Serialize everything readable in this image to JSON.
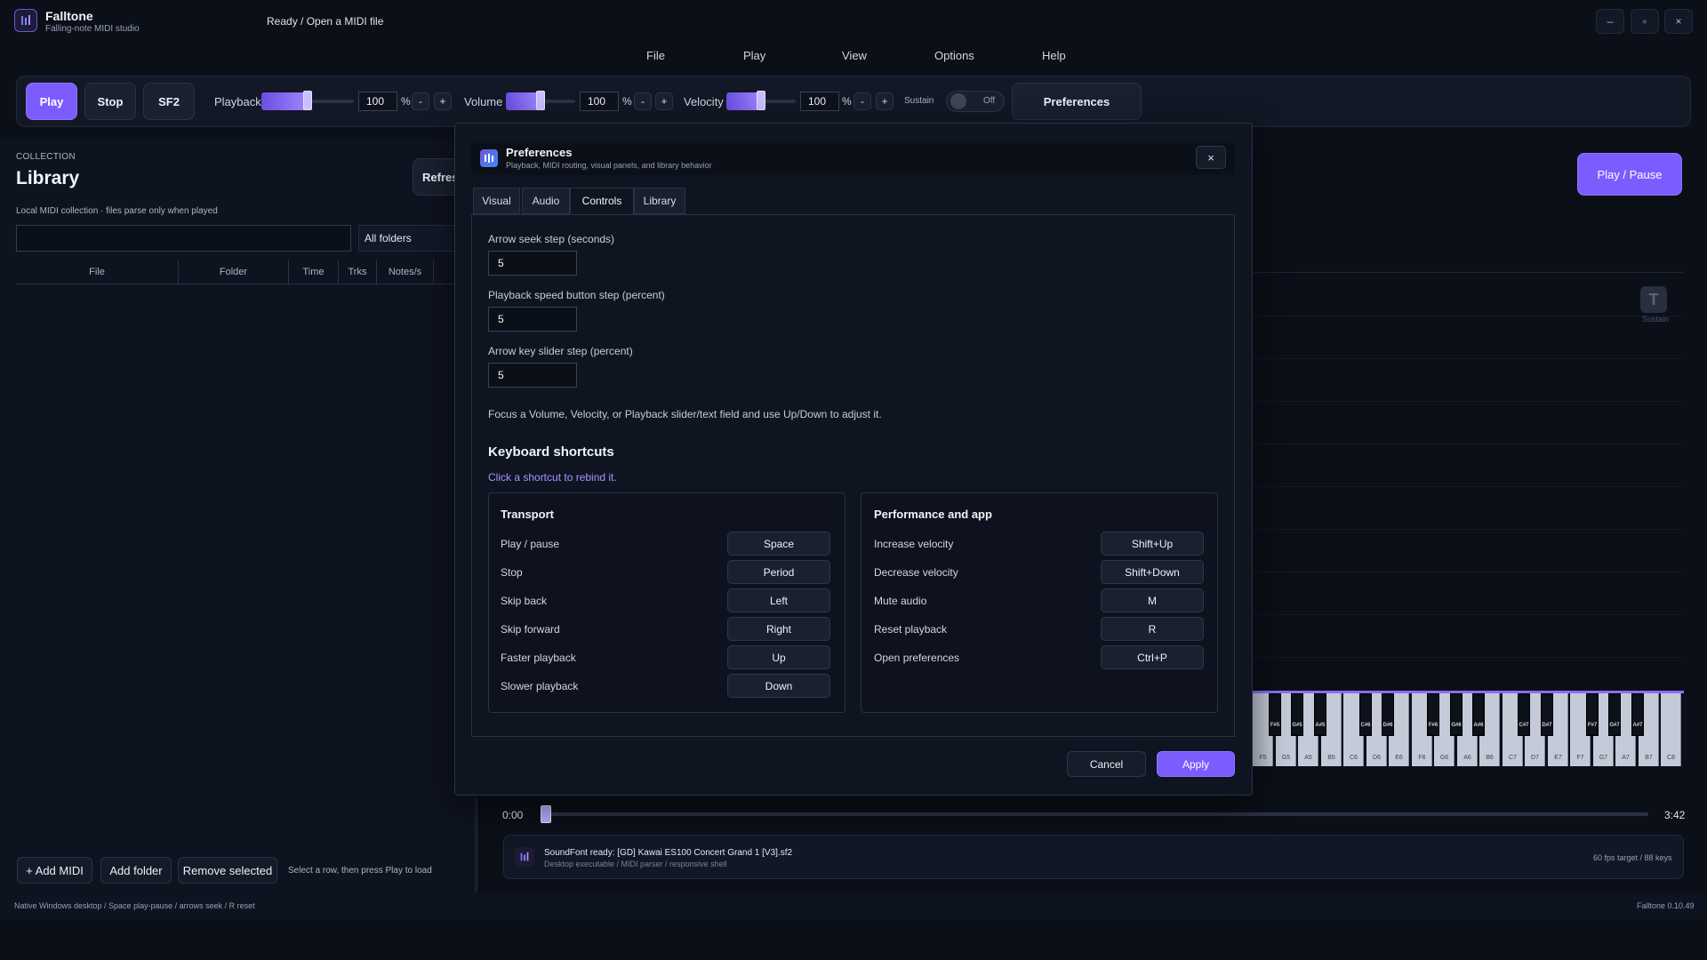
{
  "app": {
    "title": "Falltone",
    "subtitle": "Falling-note MIDI studio",
    "status": "Ready / Open a MIDI file",
    "version": "Falltone 0.10.49"
  },
  "window_controls": {
    "minimize": "–",
    "maximize": "▫",
    "close": "×"
  },
  "menu": [
    "File",
    "Play",
    "View",
    "Options",
    "Help"
  ],
  "toolbar": {
    "play_label": "Play",
    "stop_label": "Stop",
    "sf2_label": "SF2",
    "playback": {
      "label": "Playback",
      "value": "100",
      "unit": "%",
      "level": 0.5
    },
    "volume": {
      "label": "Volume",
      "value": "100",
      "unit": "%",
      "level": 0.5
    },
    "velocity": {
      "label": "Velocity",
      "value": "100",
      "unit": "%",
      "level": 0.5
    },
    "minus": "-",
    "plus": "+",
    "sustain_label": "Sustain",
    "sustain_state": "Off",
    "preferences_label": "Preferences"
  },
  "library": {
    "section_label": "COLLECTION",
    "title": "Library",
    "refresh_label": "Refresh",
    "description": "Local MIDI collection · files parse only when played",
    "search_value": "",
    "folder_filter": "All folders",
    "columns": [
      "File",
      "Folder",
      "Time",
      "Trks",
      "Notes/s"
    ],
    "add_midi": "+ Add MIDI",
    "add_folder": "Add folder",
    "remove_selected": "Remove selected",
    "hint": "Select a row, then press Play to load"
  },
  "player": {
    "play_pause_label": "Play / Pause",
    "sustain_indicator": "Sustain",
    "time_start": "0:00",
    "time_end": "3:42",
    "progress": 0.0,
    "soundfont_status": "SoundFont ready: [GD] Kawai ES100 Concert Grand 1 [V3].sf2",
    "soundfont_sub": "Desktop executable / MIDI parser / responsive shell",
    "fps_info": "60 fps target / 88 keys",
    "white_keys": [
      "F5",
      "G5",
      "A5",
      "B5",
      "C6",
      "D6",
      "E6",
      "F6",
      "G6",
      "A6",
      "B6",
      "C7",
      "D7",
      "E7",
      "F7",
      "G7",
      "A7",
      "B7",
      "C8"
    ],
    "black_keys": [
      {
        "label": "F#5",
        "after": 0
      },
      {
        "label": "G#5",
        "after": 1
      },
      {
        "label": "A#5",
        "after": 2
      },
      {
        "label": "C#6",
        "after": 4
      },
      {
        "label": "D#6",
        "after": 5
      },
      {
        "label": "F#6",
        "after": 7
      },
      {
        "label": "G#6",
        "after": 8
      },
      {
        "label": "A#6",
        "after": 9
      },
      {
        "label": "C#7",
        "after": 11
      },
      {
        "label": "D#7",
        "after": 12
      },
      {
        "label": "F#7",
        "after": 14
      },
      {
        "label": "G#7",
        "after": 15
      },
      {
        "label": "A#7",
        "after": 16
      }
    ]
  },
  "footer": {
    "left": "Native Windows desktop / Space play-pause / arrows seek / R reset"
  },
  "dialog": {
    "title": "Preferences",
    "subtitle": "Playback, MIDI routing, visual panels, and library behavior",
    "close": "×",
    "tabs": [
      "Visual",
      "Audio",
      "Controls",
      "Library"
    ],
    "active_tab": "Controls",
    "fields": [
      {
        "label": "Arrow seek step (seconds)",
        "value": "5"
      },
      {
        "label": "Playback speed button step (percent)",
        "value": "5"
      },
      {
        "label": "Arrow key slider step (percent)",
        "value": "5"
      }
    ],
    "help_text": "Focus a Volume, Velocity, or Playback slider/text field and use Up/Down to adjust it.",
    "shortcuts_title": "Keyboard shortcuts",
    "shortcuts_hint": "Click a shortcut to rebind it.",
    "transport": {
      "title": "Transport",
      "items": [
        {
          "label": "Play / pause",
          "key": "Space"
        },
        {
          "label": "Stop",
          "key": "Period"
        },
        {
          "label": "Skip back",
          "key": "Left"
        },
        {
          "label": "Skip forward",
          "key": "Right"
        },
        {
          "label": "Faster playback",
          "key": "Up"
        },
        {
          "label": "Slower playback",
          "key": "Down"
        }
      ]
    },
    "performance": {
      "title": "Performance and app",
      "items": [
        {
          "label": "Increase velocity",
          "key": "Shift+Up"
        },
        {
          "label": "Decrease velocity",
          "key": "Shift+Down"
        },
        {
          "label": "Mute audio",
          "key": "M"
        },
        {
          "label": "Reset playback",
          "key": "R"
        },
        {
          "label": "Open preferences",
          "key": "Ctrl+P"
        }
      ]
    },
    "cancel_label": "Cancel",
    "apply_label": "Apply"
  },
  "colors": {
    "accent": "#7c5cff",
    "background": "#0b0f18",
    "panel": "#131826"
  }
}
